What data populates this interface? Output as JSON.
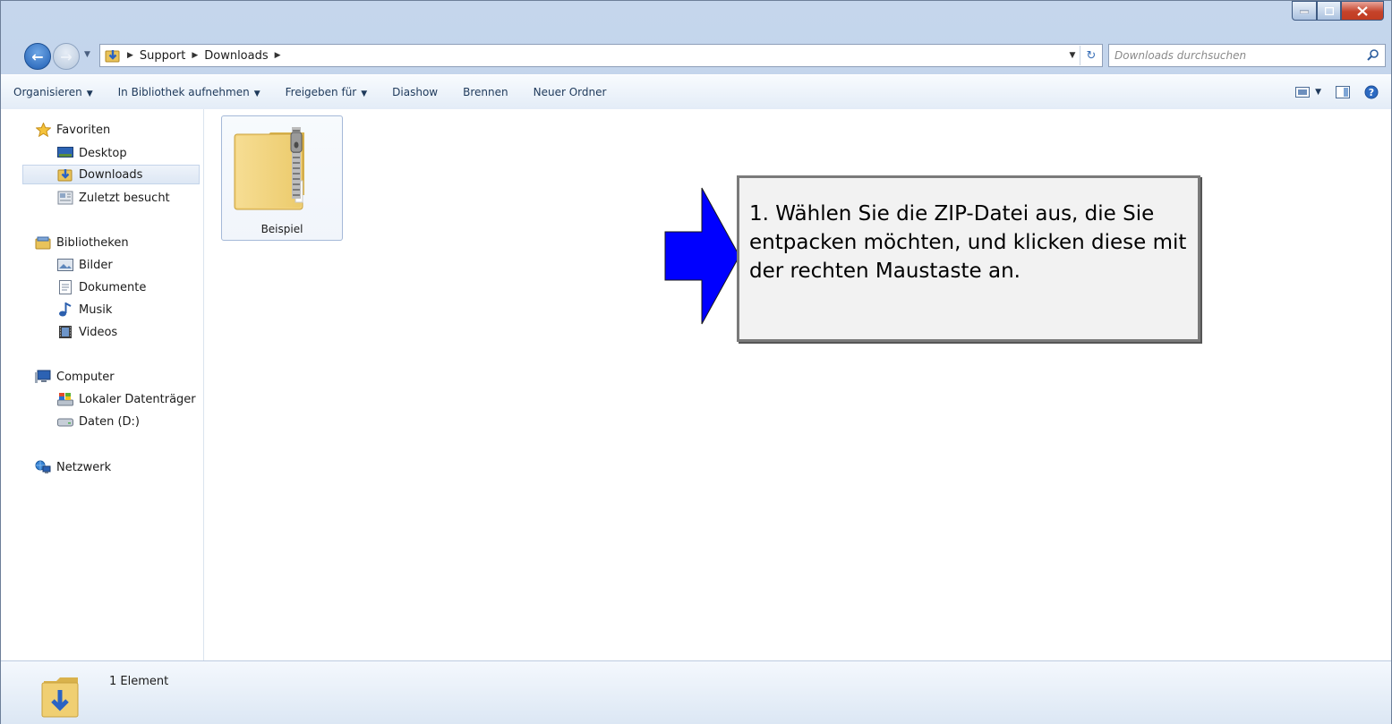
{
  "address": {
    "crumbs": [
      "Support",
      "Downloads"
    ],
    "search_placeholder": "Downloads durchsuchen"
  },
  "toolbar": {
    "organize": "Organisieren",
    "include_library": "In Bibliothek aufnehmen",
    "share": "Freigeben für",
    "slideshow": "Diashow",
    "burn": "Brennen",
    "new_folder": "Neuer Ordner"
  },
  "sidebar": {
    "favorites": "Favoriten",
    "desktop": "Desktop",
    "downloads": "Downloads",
    "recent": "Zuletzt besucht",
    "libraries": "Bibliotheken",
    "pictures": "Bilder",
    "documents": "Dokumente",
    "music": "Musik",
    "videos": "Videos",
    "computer": "Computer",
    "local_disk": "Lokaler Datenträger",
    "data_drive": "Daten (D:)",
    "network": "Netzwerk"
  },
  "files": [
    {
      "name": "Beispiel",
      "icon": "zip-folder-icon",
      "selected": true
    }
  ],
  "status": {
    "count": "1 Element"
  },
  "callout": {
    "text": "1. Wählen Sie die ZIP-Datei aus, die Sie entpacken möchten, und klicken diese mit der rechten Maustaste an."
  },
  "colors": {
    "arrow": "#0000ff",
    "accent": "#1e395b"
  }
}
